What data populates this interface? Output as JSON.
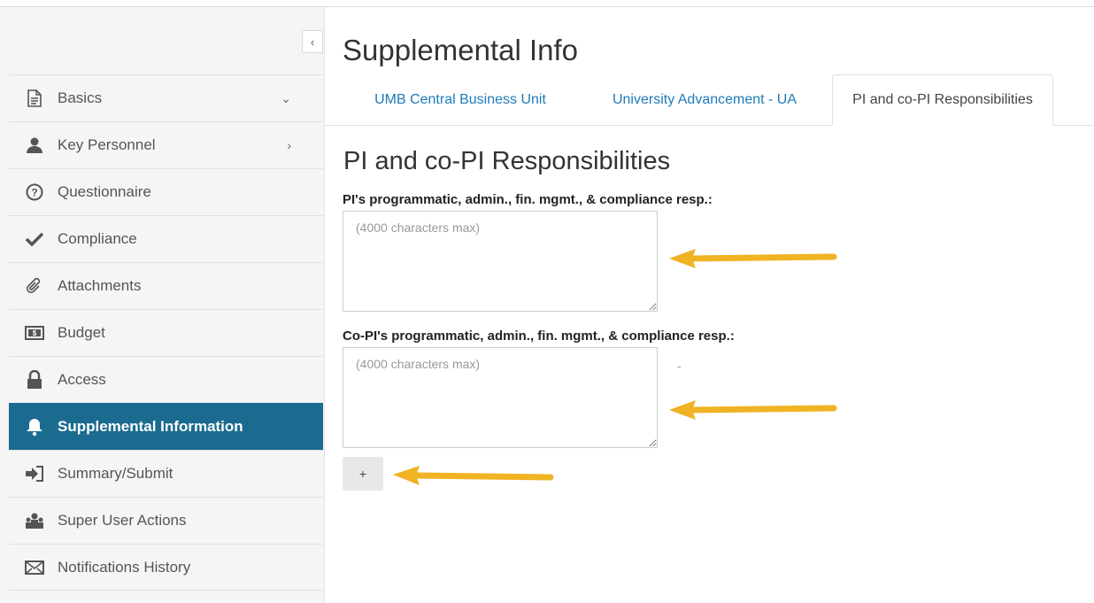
{
  "sidebar": {
    "collapse_icon": "chevron-left-icon",
    "items": [
      {
        "label": "Basics",
        "icon": "document-icon",
        "suffix": "⌄",
        "active": false
      },
      {
        "label": "Key Personnel",
        "icon": "person-icon",
        "suffix": "›",
        "active": false
      },
      {
        "label": "Questionnaire",
        "icon": "question-circle-icon",
        "suffix": "",
        "active": false
      },
      {
        "label": "Compliance",
        "icon": "checkmark-icon",
        "suffix": "",
        "active": false
      },
      {
        "label": "Attachments",
        "icon": "paperclip-icon",
        "suffix": "",
        "active": false
      },
      {
        "label": "Budget",
        "icon": "money-icon",
        "suffix": "",
        "active": false
      },
      {
        "label": "Access",
        "icon": "lock-icon",
        "suffix": "",
        "active": false
      },
      {
        "label": "Supplemental Information",
        "icon": "bell-icon",
        "suffix": "",
        "active": true
      },
      {
        "label": "Summary/Submit",
        "icon": "sign-in-icon",
        "suffix": "",
        "active": false
      },
      {
        "label": "Super User Actions",
        "icon": "users-icon",
        "suffix": "",
        "active": false
      },
      {
        "label": "Notifications History",
        "icon": "envelope-icon",
        "suffix": "",
        "active": false
      }
    ]
  },
  "main": {
    "title": "Supplemental Info",
    "tabs": [
      {
        "label": "UMB Central Business Unit",
        "active": false
      },
      {
        "label": "University Advancement - UA",
        "active": false
      },
      {
        "label": "PI and co-PI Responsibilities",
        "active": true
      }
    ],
    "section_title": "PI and co-PI Responsibilities",
    "fields": [
      {
        "label": "PI's programmatic, admin., fin. mgmt., & compliance resp.:",
        "placeholder": "(4000 characters max)",
        "value": ""
      },
      {
        "label": "Co-PI's programmatic, admin., fin. mgmt., & compliance resp.:",
        "placeholder": "(4000 characters max)",
        "value": ""
      }
    ],
    "dash_text": "-",
    "add_button_label": "+"
  },
  "colors": {
    "active_nav_bg": "#1a6b8f",
    "link_blue": "#1e7ab8",
    "annotation_arrow": "#f0b323"
  }
}
